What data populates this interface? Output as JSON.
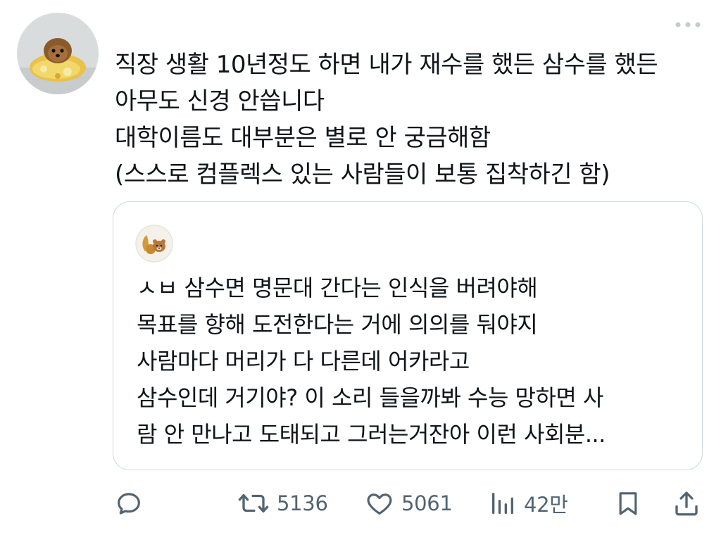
{
  "tweet": {
    "lines": [
      "직장 생활 10년정도 하면 내가 재수를 했든 삼수를 했든",
      "아무도 신경 안씁니다",
      "대학이름도 대부분은 별로 안 궁금해함",
      "(스스로 컴플렉스 있는 사람들이 보통 집착하긴 함)"
    ]
  },
  "quote": {
    "lines": [
      "ㅅㅂ 삼수면 명문대 간다는 인식을 버려야해",
      "목표를 향해 도전한다는 거에 의의를 둬야지",
      "사람마다 머리가 다 다른데 어카라고",
      "삼수인데 거기야? 이 소리 들을까봐 수능 망하면 사",
      "람 안 만나고 도태되고 그러는거잔아 이런 사회분..."
    ]
  },
  "actions": {
    "retweets": "5136",
    "likes": "5061",
    "views": "42만"
  },
  "icons": {
    "more": "more-dots-icon",
    "reply": "reply-icon",
    "retweet": "retweet-icon",
    "like": "heart-icon",
    "views": "views-chart-icon",
    "bookmark": "bookmark-icon",
    "share": "share-icon"
  },
  "colors": {
    "text": "#0f1419",
    "muted": "#536471",
    "border": "#cfd9de"
  }
}
